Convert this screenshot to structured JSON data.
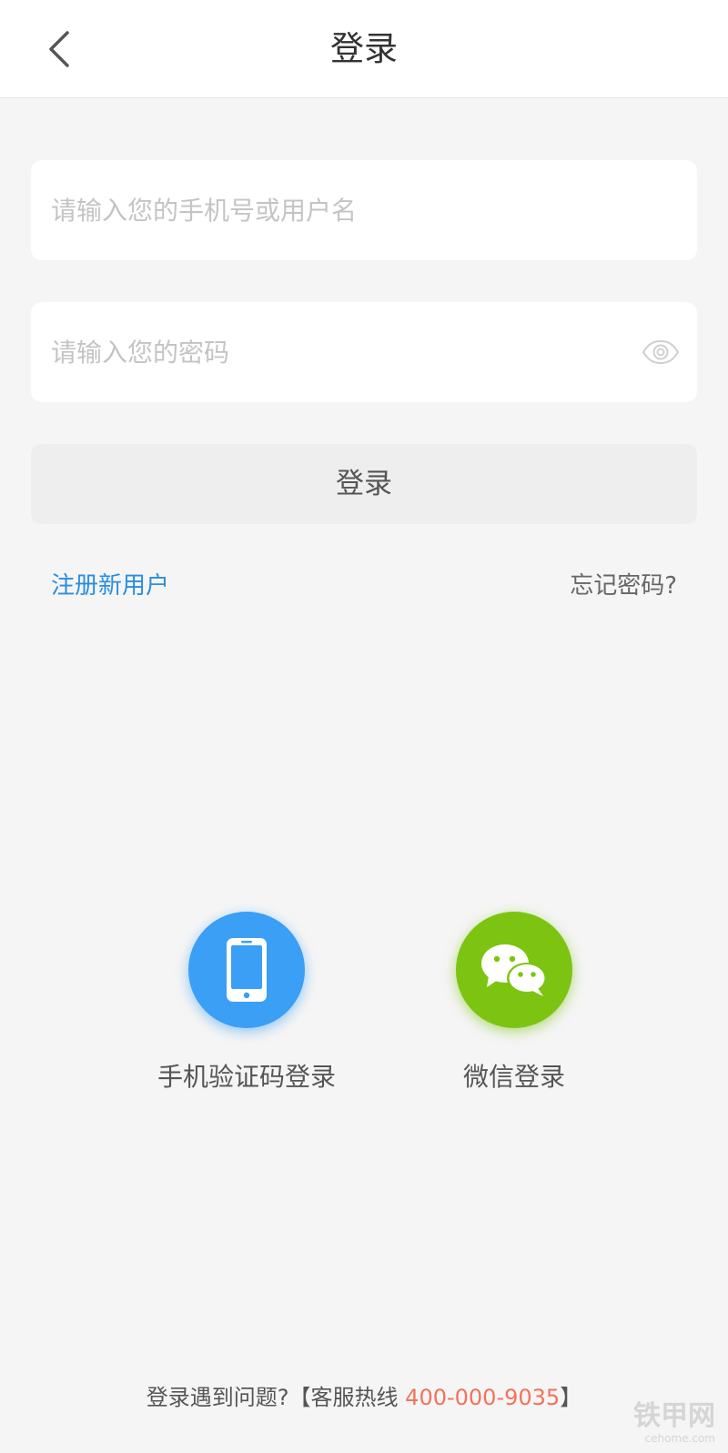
{
  "header": {
    "title": "登录",
    "back_icon": "chevron-left-icon"
  },
  "username": {
    "value": "",
    "placeholder": "请输入您的手机号或用户名"
  },
  "password": {
    "value": "",
    "placeholder": "请输入您的密码",
    "toggle_icon": "eye-icon"
  },
  "login_button": {
    "label": "登录"
  },
  "links": {
    "register": "注册新用户",
    "forgot": "忘记密码?"
  },
  "alt_login": [
    {
      "label": "手机验证码登录",
      "icon": "phone-icon",
      "color": "#3a9ff5"
    },
    {
      "label": "微信登录",
      "icon": "wechat-icon",
      "color": "#7dc412"
    }
  ],
  "footer": {
    "help_prefix": "登录遇到问题?【客服热线 ",
    "hotline": "400-000-9035",
    "help_suffix": "】"
  },
  "watermark": {
    "main": "铁甲网",
    "sub": "cehome.com"
  },
  "colors": {
    "link_blue": "#2a8ee0",
    "hotline_orange": "#f2735a",
    "background": "#f5f5f5"
  }
}
